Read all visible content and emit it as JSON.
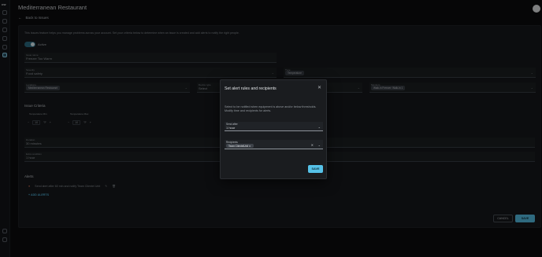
{
  "app": {
    "logo": "cw"
  },
  "page": {
    "title": "Mediterranean Restaurant",
    "back_label": "Back to Issues",
    "avatar": ""
  },
  "form": {
    "description": "This Issues feature helps you manage problems across your account. Set your criteria below to determine when an issue is created and add alerts to notify the right people.",
    "active_label": "Active",
    "issue_name": {
      "label": "Issue name",
      "value": "Freezer Too Warm"
    },
    "severity": {
      "label": "Severity",
      "value": "Food safety"
    },
    "type": {
      "label": "Type",
      "value": "Temperature"
    },
    "locations": {
      "label": "Locations",
      "chip": "Mediterranean Restaurant"
    },
    "device_type": {
      "label": "Device type",
      "value": "Select"
    },
    "equipment": {
      "label": "Equipment",
      "chip": "Walk-in Freezer"
    },
    "monitors": {
      "label": "Monitors",
      "chip": "Walk-in Freezer: Walk-in 1"
    }
  },
  "criteria": {
    "heading": "Issue Criteria",
    "temp_min": {
      "label": "Temperature Min",
      "value": "10",
      "unit": "°F"
    },
    "temp_max": {
      "label": "Temperature Max",
      "value": "10",
      "unit": "°F"
    },
    "duration": {
      "label": "Duration",
      "value": "30 minutes"
    },
    "extra_condition": {
      "label": "Extra condition",
      "value": "1 hour"
    }
  },
  "alerts": {
    "heading": "Alerts",
    "row_text": "Send alert after 60 min and notify Team Clientel Unit",
    "add_label": "ADD ALERTS"
  },
  "footer": {
    "cancel_label": "CANCEL",
    "save_label": "SAVE"
  },
  "modal": {
    "title": "Set alert rules and recipients",
    "close_glyph": "✕",
    "description": "Select to be notified when equipment is above and/or below thresholds. Modify time and recipients for alerts.",
    "send_after": {
      "label": "Send after",
      "value": "1 hour"
    },
    "recipients": {
      "label": "Recipients",
      "chip": "Team ClientelUnit"
    },
    "save_label": "SAVE"
  },
  "colors": {
    "accent": "#56c2e8",
    "background": "#0b0c0e",
    "modal_bg": "#1a1c1f"
  }
}
